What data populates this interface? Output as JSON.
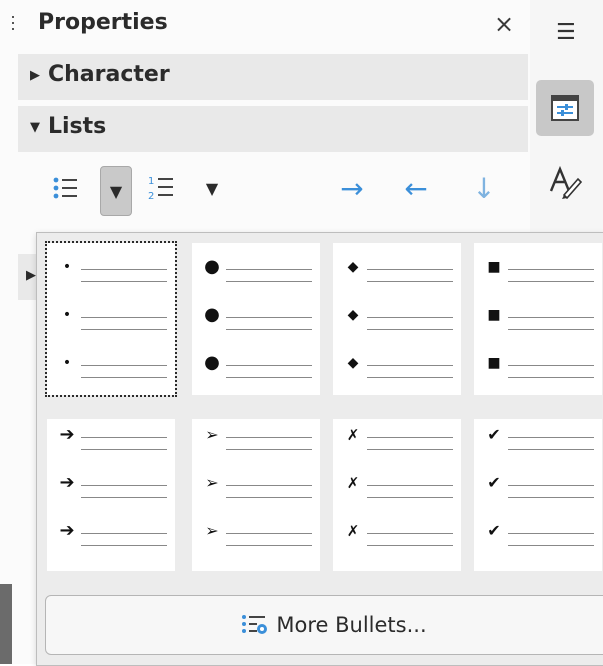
{
  "panel": {
    "title": "Properties",
    "close_glyph": "×",
    "sections": [
      {
        "label": "Character",
        "expanded": false,
        "triangle": "▶"
      },
      {
        "label": "Lists",
        "expanded": true,
        "triangle": "▼"
      }
    ]
  },
  "toolbar": {
    "icons": [
      "unordered-list-icon",
      "dropdown-arrow-icon",
      "ordered-list-icon",
      "dropdown-arrow-icon",
      "demote-arrow-icon",
      "promote-arrow-icon",
      "move-down-arrow-icon"
    ],
    "dropdown_glyph": "▼",
    "demote_glyph": "→",
    "promote_glyph": "←",
    "move_down_glyph": "↓"
  },
  "deck": {
    "menu_glyph": "☰",
    "items": [
      "properties-deck-icon",
      "styles-deck-icon"
    ]
  },
  "bullets_popup": {
    "styles": [
      {
        "symbol": "•",
        "selected": true
      },
      {
        "symbol": "●",
        "selected": false
      },
      {
        "symbol": "◆",
        "selected": false
      },
      {
        "symbol": "■",
        "selected": false
      },
      {
        "symbol": "➔",
        "selected": false
      },
      {
        "symbol": "➢",
        "selected": false
      },
      {
        "symbol": "✗",
        "selected": false
      },
      {
        "symbol": "✔",
        "selected": false
      }
    ],
    "more_label": "More Bullets..."
  },
  "colors": {
    "accent_arrow": "#3b8fd9",
    "section_bg": "#e9e9e9",
    "selected_deck_bg": "#c8c8c8"
  }
}
